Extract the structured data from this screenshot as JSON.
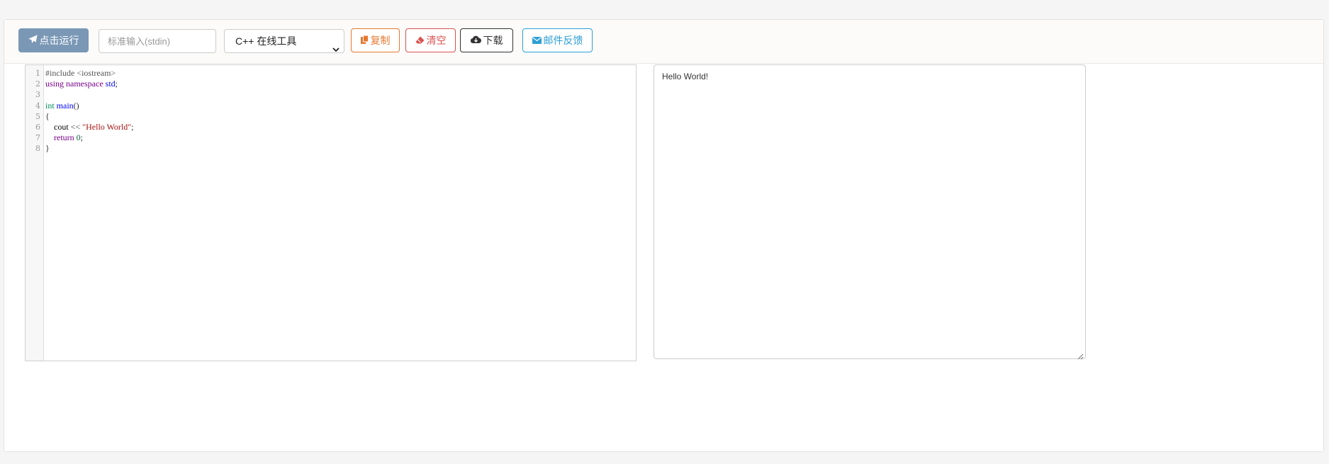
{
  "toolbar": {
    "run_label": "点击运行",
    "stdin_placeholder": "标准输入(stdin)",
    "language_select_value": "C++ 在线工具",
    "copy_label": "复制",
    "clear_label": "清空",
    "download_label": "下载",
    "feedback_label": "邮件反馈"
  },
  "icons": {
    "run": "paper-plane-icon",
    "copy": "copy-icon",
    "clear": "eraser-icon",
    "download": "cloud-download-icon",
    "feedback": "envelope-icon",
    "select_caret": "chevron-down-icon",
    "resize": "resize-handle-icon"
  },
  "colors": {
    "run": "#7a98b6",
    "copy": "#e8782f",
    "clear": "#d9534f",
    "download": "#333333",
    "feedback": "#2c9fd6"
  },
  "editor": {
    "line_numbers": [
      "1",
      "2",
      "3",
      "4",
      "5",
      "6",
      "7",
      "8"
    ],
    "lines": [
      [
        {
          "t": "#include <iostream>",
          "c": "meta"
        }
      ],
      [
        {
          "t": "using",
          "c": "kw"
        },
        {
          "t": " ",
          "c": "var"
        },
        {
          "t": "namespace",
          "c": "kw"
        },
        {
          "t": " ",
          "c": "var"
        },
        {
          "t": "std",
          "c": "def"
        },
        {
          "t": ";",
          "c": "punc"
        }
      ],
      [],
      [
        {
          "t": "int",
          "c": "type"
        },
        {
          "t": " ",
          "c": "var"
        },
        {
          "t": "main",
          "c": "def"
        },
        {
          "t": "()",
          "c": "punc"
        }
      ],
      [
        {
          "t": "{",
          "c": "punc"
        }
      ],
      [
        {
          "t": "    cout ",
          "c": "var"
        },
        {
          "t": "<<",
          "c": "punc"
        },
        {
          "t": " ",
          "c": "var"
        },
        {
          "t": "\"Hello World\"",
          "c": "str"
        },
        {
          "t": ";",
          "c": "punc"
        }
      ],
      [
        {
          "t": "    ",
          "c": "var"
        },
        {
          "t": "return",
          "c": "kw"
        },
        {
          "t": " ",
          "c": "var"
        },
        {
          "t": "0",
          "c": "num"
        },
        {
          "t": ";",
          "c": "punc"
        }
      ],
      [
        {
          "t": "}",
          "c": "punc"
        }
      ]
    ]
  },
  "output": {
    "text": "Hello World!"
  }
}
